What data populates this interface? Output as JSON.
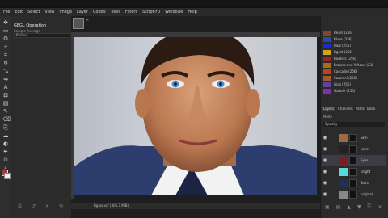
{
  "menubar": [
    "File",
    "Edit",
    "Select",
    "View",
    "Image",
    "Layer",
    "Colors",
    "Tools",
    "Filters",
    "Script-Fu",
    "Windows",
    "Help"
  ],
  "tools": [
    "move-icon",
    "select-icon",
    "lasso-icon",
    "fuzzy-select-icon",
    "crop-icon",
    "rotate-icon",
    "scale-icon",
    "flip-icon",
    "text-icon",
    "bucket-icon",
    "gradient-icon",
    "paintbrush-icon",
    "eraser-icon",
    "clone-icon",
    "smudge-icon",
    "dodge-icon",
    "path-icon",
    "color-picker-icon",
    "zoom-icon"
  ],
  "tool_glyphs": [
    "✥",
    "▭",
    "ʘ",
    "✧",
    "⌗",
    "↻",
    "⤡",
    "⇋",
    "A",
    "⛾",
    "▤",
    "✎",
    "⌫",
    "⎘",
    "☁",
    "◐",
    "✒",
    "⊙",
    "⌕"
  ],
  "tool_options": {
    "title": "GEGL Operation",
    "subtitle": "Sample Average",
    "field": "Radius"
  },
  "colors": {
    "foreground": "#a03a3f",
    "background": "#eeeeee",
    "accent": "#3c3c46"
  },
  "status": {
    "text": "Bg.ae.xcf (306.7 MiB)"
  },
  "palettes": [
    {
      "label": "Bears (256)",
      "color": "#7a4a2a"
    },
    {
      "label": "Blues (256)",
      "color": "#2a4a9a"
    },
    {
      "label": "Blue (256)",
      "color": "#1a2ad0"
    },
    {
      "label": "Bgold (256)",
      "color": "#d0a020"
    },
    {
      "label": "Borders (256)",
      "color": "#a02030"
    },
    {
      "label": "Browns and Yellows (23)",
      "color": "#a07020"
    },
    {
      "label": "Cascade (256)",
      "color": "#c04020"
    },
    {
      "label": "Caramel (256)",
      "color": "#a05a30"
    },
    {
      "label": "Gica (256)",
      "color": "#6040a0"
    },
    {
      "label": "Gabble (256)",
      "color": "#8030a0"
    }
  ],
  "right_tabs": [
    "Layers",
    "Channels",
    "Paths",
    "Undo"
  ],
  "layers_mode": "Mode",
  "opacity": "Opacity",
  "layers": [
    {
      "name": "Skin",
      "thumb": "#a06a4a",
      "selected": false
    },
    {
      "name": "Layer",
      "thumb": "#222222",
      "selected": false
    },
    {
      "name": "Eyes",
      "thumb": "#7a1e1e",
      "selected": true
    },
    {
      "name": "Bright",
      "thumb": "#5ad8e0",
      "selected": false
    },
    {
      "name": "Suits",
      "thumb": "#203050",
      "selected": false
    },
    {
      "name": "original",
      "thumb": "#888888",
      "selected": false
    }
  ]
}
